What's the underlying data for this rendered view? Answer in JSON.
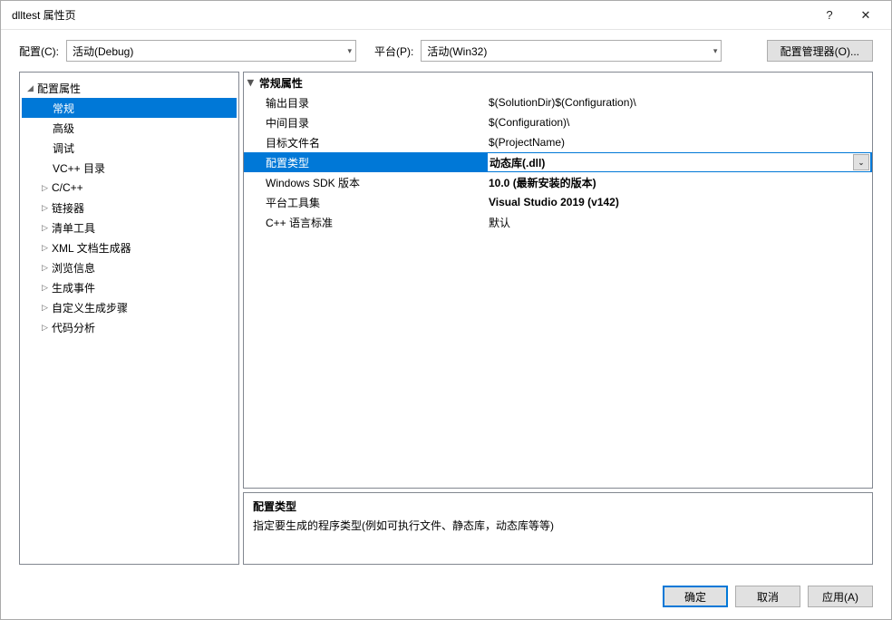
{
  "titlebar": {
    "title": "dlltest 属性页",
    "help": "?",
    "close": "✕"
  },
  "topbar": {
    "config_label": "配置(C):",
    "config_value": "活动(Debug)",
    "platform_label": "平台(P):",
    "platform_value": "活动(Win32)",
    "manager_label": "配置管理器(O)..."
  },
  "tree": {
    "root": "配置属性",
    "items": [
      {
        "label": "常规",
        "expandable": false,
        "selected": true
      },
      {
        "label": "高级",
        "expandable": false
      },
      {
        "label": "调试",
        "expandable": false
      },
      {
        "label": "VC++ 目录",
        "expandable": false
      },
      {
        "label": "C/C++",
        "expandable": true
      },
      {
        "label": "链接器",
        "expandable": true
      },
      {
        "label": "清单工具",
        "expandable": true
      },
      {
        "label": "XML 文档生成器",
        "expandable": true
      },
      {
        "label": "浏览信息",
        "expandable": true
      },
      {
        "label": "生成事件",
        "expandable": true
      },
      {
        "label": "自定义生成步骤",
        "expandable": true
      },
      {
        "label": "代码分析",
        "expandable": true
      }
    ]
  },
  "grid": {
    "header": "常规属性",
    "rows": [
      {
        "label": "输出目录",
        "value": "$(SolutionDir)$(Configuration)\\"
      },
      {
        "label": "中间目录",
        "value": "$(Configuration)\\"
      },
      {
        "label": "目标文件名",
        "value": "$(ProjectName)"
      },
      {
        "label": "配置类型",
        "value": "动态库(.dll)",
        "selected": true,
        "bold": true
      },
      {
        "label": "Windows SDK 版本",
        "value": "10.0 (最新安装的版本)",
        "bold": true
      },
      {
        "label": "平台工具集",
        "value": "Visual Studio 2019 (v142)",
        "bold": true
      },
      {
        "label": "C++ 语言标准",
        "value": "默认"
      }
    ]
  },
  "desc": {
    "title": "配置类型",
    "text": "指定要生成的程序类型(例如可执行文件、静态库，动态库等等)"
  },
  "footer": {
    "ok": "确定",
    "cancel": "取消",
    "apply": "应用(A)"
  }
}
